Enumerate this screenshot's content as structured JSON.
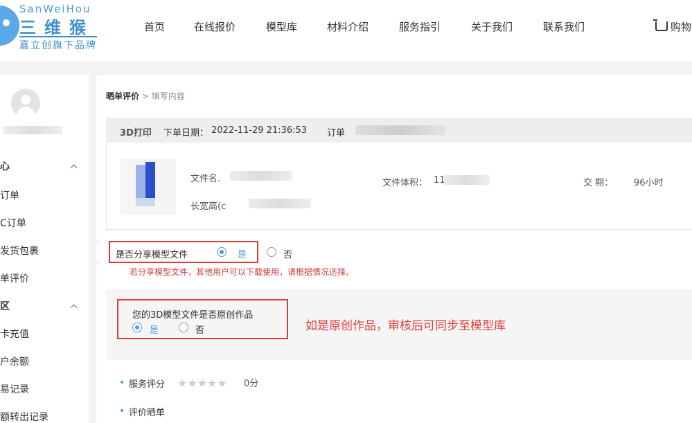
{
  "brand": {
    "name_en": "SanWeiHou",
    "name_cn": "三维猴",
    "tagline": "嘉立创旗下品牌"
  },
  "nav": {
    "items": [
      "首页",
      "在线报价",
      "模型库",
      "材料介绍",
      "服务指引",
      "关于我们",
      "联系我们"
    ],
    "cart": "购物"
  },
  "sidebar": {
    "items": [
      "心",
      "订单",
      "C订单",
      "发货包裹",
      "单评价",
      "区",
      "卡充值",
      "户余额",
      "易记录",
      "额转出记录"
    ]
  },
  "breadcrumb": {
    "root": "晒单评价",
    "separator": ">",
    "current": "填写内容"
  },
  "order": {
    "type": "3D打印",
    "date_label": "下单日期：",
    "date_value": "2022-11-29 21:36:53",
    "number_label": "订单"
  },
  "product": {
    "filename_label": "文件名.",
    "size_label": "长宽高(c",
    "volume_label": "文件体积：",
    "volume_value": "11",
    "delivery_label": "交    期：",
    "delivery_value": "96小时"
  },
  "share": {
    "label": "是否分享模型文件",
    "yes": "是",
    "no": "否",
    "selected": "是",
    "hint": "若分享模型文件，其他用户可以下载使用，请根据情况选择。"
  },
  "original": {
    "question": "您的3D模型文件是否原创作品",
    "yes": "是",
    "no": "否",
    "selected": "是",
    "annotation": "如是原创作品，审核后可同步至模型库"
  },
  "rating": {
    "label": "服务评分",
    "stars_filled": 0,
    "stars_total": 5,
    "score": "0分"
  },
  "review": {
    "label": "评价晒单"
  },
  "colors": {
    "accent": "#4a9fdc",
    "highlight_red": "#e03b3b"
  }
}
